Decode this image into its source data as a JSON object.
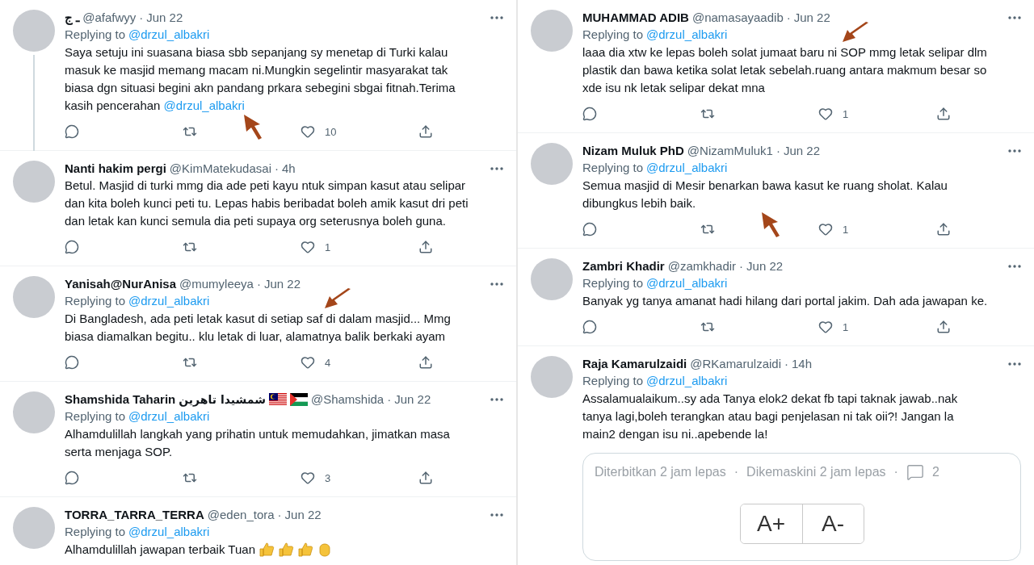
{
  "columns": [
    {
      "tweets": [
        {
          "name": "ـ ج",
          "handle": "@afafwyy",
          "separator": "·",
          "time": "Jun 22",
          "replying_prefix": "Replying to",
          "reply_handle": "@drzul_albakri",
          "text": "Saya setuju ini suasana biasa sbb sepanjang sy menetap di Turki kalau masuk ke masjid memang macam ni.Mungkin segelintir masyarakat tak biasa dgn situasi begini akn pandang prkara sebegini sbgai fitnah.Terima kasih pencerahan",
          "mention": "@drzul_albakri",
          "likes": "10",
          "thread_line": true,
          "annotation_arrow": {
            "kind": "up-left"
          }
        },
        {
          "name": "Nanti hakim pergi",
          "handle": "@KimMatekudasai",
          "separator": "·",
          "time": "4h",
          "text": "Betul. Masjid di turki mmg dia ade peti kayu ntuk simpan kasut atau selipar dan kita boleh kunci peti tu. Lepas habis beribadat boleh amik kasut dri peti dan letak kan kunci semula dia peti supaya org seterusnya boleh guna.",
          "likes": "1",
          "thread_line": false
        },
        {
          "name": "Yanisah@NurAnisa",
          "handle": "@mumyleeya",
          "separator": "·",
          "time": "Jun 22",
          "replying_prefix": "Replying to",
          "reply_handle": "@drzul_albakri",
          "text": "Di Bangladesh, ada peti letak kasut di setiap saf di dalam masjid... Mmg biasa diamalkan begitu.. klu letak di luar, alamatnya balik berkaki ayam",
          "likes": "4",
          "thread_line": false,
          "annotation_arrow": {
            "kind": "down-left"
          }
        },
        {
          "name": "Shamshida Taharin",
          "name_extra": "شمشيدا تاهرين",
          "name_flags": [
            {
              "kind": "malaysia"
            },
            {
              "kind": "palestine"
            }
          ],
          "handle": "@Shamshida",
          "separator": "·",
          "time": "Jun 22",
          "replying_prefix": "Replying to",
          "reply_handle": "@drzul_albakri",
          "text": "Alhamdulillah langkah yang prihatin untuk memudahkan, jimatkan masa serta menjaga SOP.",
          "likes": "3",
          "thread_line": false
        },
        {
          "name": "TORRA_TARRA_TERRA",
          "handle": "@eden_tora",
          "separator": "·",
          "time": "Jun 22",
          "replying_prefix": "Replying to",
          "reply_handle": "@drzul_albakri",
          "text": "Alhamdulillah jawapan terbaik Tuan",
          "text_emojis": [
            {
              "kind": "thumbs-up"
            },
            {
              "kind": "thumbs-up"
            },
            {
              "kind": "thumbs-up"
            },
            {
              "kind": "clap"
            }
          ],
          "thread_line": false
        }
      ]
    },
    {
      "tweets": [
        {
          "name": "MUHAMMAD ADIB",
          "handle": "@namasayaadib",
          "separator": "·",
          "time": "Jun 22",
          "replying_prefix": "Replying to",
          "reply_handle": "@drzul_albakri",
          "text": "laaa dia xtw ke lepas boleh solat jumaat baru ni SOP mmg letak selipar dlm plastik dan bawa ketika solat letak sebelah.ruang antara makmum besar so xde isu nk letak selipar dekat mna",
          "likes": "1",
          "thread_line": false,
          "annotation_arrow": {
            "kind": "down-left"
          }
        },
        {
          "name": "Nizam Muluk PhD",
          "handle": "@NizamMuluk1",
          "separator": "·",
          "time": "Jun 22",
          "replying_prefix": "Replying to",
          "reply_handle": "@drzul_albakri",
          "text": "Semua masjid di Mesir benarkan bawa kasut ke ruang sholat. Kalau dibungkus lebih baik.",
          "likes": "1",
          "thread_line": false,
          "annotation_arrow": {
            "kind": "up-left"
          }
        },
        {
          "name": "Zambri Khadir",
          "handle": "@zamkhadir",
          "separator": "·",
          "time": "Jun 22",
          "replying_prefix": "Replying to",
          "reply_handle": "@drzul_albakri",
          "text": "Banyak yg tanya amanat hadi hilang dari portal jakim. Dah ada jawapan ke.",
          "likes": "1",
          "thread_line": false
        },
        {
          "name": "Raja Kamarulzaidi",
          "handle": "@RKamarulzaidi",
          "separator": "·",
          "time": "14h",
          "replying_prefix": "Replying to",
          "reply_handle": "@drzul_albakri",
          "text": "Assalamualaikum..sy ada Tanya elok2 dekat fb tapi taknak jawab..nak tanya lagi,boleh terangkan atau bagi penjelasan ni tak oii?! Jangan la main2 dengan isu ni..apebende la!",
          "thread_line": false,
          "embed": {
            "published": "Diterbitkan 2 jam lepas",
            "separator": "·",
            "updated": "Dikemaskini 2 jam lepas",
            "comments": "2",
            "font_buttons": [
              "A+",
              "A-"
            ]
          }
        }
      ]
    }
  ]
}
